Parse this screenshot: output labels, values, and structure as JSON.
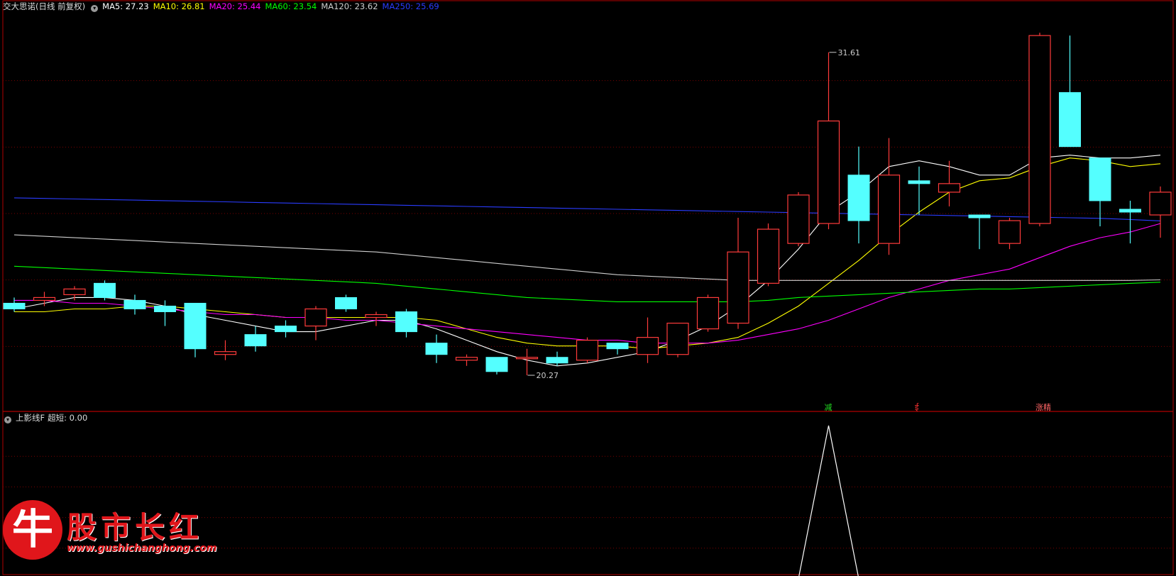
{
  "header": {
    "title": "交大思诺(日线 前复权)",
    "ma": [
      {
        "label": "MA5: 27.23",
        "color": "#ffffff"
      },
      {
        "label": "MA10: 26.81",
        "color": "#ffff00"
      },
      {
        "label": "MA20: 25.44",
        "color": "#ff00ff"
      },
      {
        "label": "MA60: 23.54",
        "color": "#00ff00"
      },
      {
        "label": "MA120: 23.62",
        "color": "#cfcfcf"
      },
      {
        "label": "MA250: 25.69",
        "color": "#2a3cff"
      }
    ]
  },
  "sub_header": {
    "name": "上影线F",
    "value_label": "超短: 0.00"
  },
  "watermark": {
    "name": "股市长红",
    "url": "www.gushichanghong.com",
    "mark": "牛"
  },
  "colors": {
    "up": "#ff3b3b",
    "down": "#54ffff",
    "grid": "#7a0000",
    "border": "#b00000"
  },
  "chart_data": [
    {
      "type": "candlestick",
      "ylim": [
        19.0,
        33.0
      ],
      "annotations": [
        {
          "index": 27,
          "value": 31.61,
          "label": "31.61"
        },
        {
          "index": 17,
          "value": 20.27,
          "label": "20.27"
        }
      ],
      "signals": [
        {
          "index": 27,
          "label": "减",
          "color": "#22dd22"
        },
        {
          "index": 30,
          "label": "ई",
          "color": "#ff3333"
        },
        {
          "index": 34,
          "label": "涨精",
          "color": "#ff6666"
        }
      ],
      "candles": [
        {
          "o": 22.8,
          "h": 23.0,
          "l": 22.5,
          "c": 22.6
        },
        {
          "o": 22.9,
          "h": 23.2,
          "l": 22.7,
          "c": 23.0
        },
        {
          "o": 23.1,
          "h": 23.4,
          "l": 22.9,
          "c": 23.3
        },
        {
          "o": 23.5,
          "h": 23.6,
          "l": 22.9,
          "c": 23.0
        },
        {
          "o": 22.9,
          "h": 23.1,
          "l": 22.4,
          "c": 22.6
        },
        {
          "o": 22.7,
          "h": 22.9,
          "l": 22.0,
          "c": 22.5
        },
        {
          "o": 22.8,
          "h": 22.8,
          "l": 20.9,
          "c": 21.2
        },
        {
          "o": 21.0,
          "h": 21.5,
          "l": 20.8,
          "c": 21.1
        },
        {
          "o": 21.7,
          "h": 22.0,
          "l": 21.1,
          "c": 21.3
        },
        {
          "o": 22.0,
          "h": 22.2,
          "l": 21.6,
          "c": 21.8
        },
        {
          "o": 22.0,
          "h": 22.7,
          "l": 21.5,
          "c": 22.6
        },
        {
          "o": 23.0,
          "h": 23.1,
          "l": 22.5,
          "c": 22.6
        },
        {
          "o": 22.3,
          "h": 22.5,
          "l": 22.0,
          "c": 22.4
        },
        {
          "o": 22.5,
          "h": 22.6,
          "l": 21.6,
          "c": 21.8
        },
        {
          "o": 21.4,
          "h": 21.7,
          "l": 20.7,
          "c": 21.0
        },
        {
          "o": 20.8,
          "h": 21.0,
          "l": 20.6,
          "c": 20.9
        },
        {
          "o": 20.9,
          "h": 20.9,
          "l": 20.3,
          "c": 20.4
        },
        {
          "o": 20.9,
          "h": 21.2,
          "l": 20.27,
          "c": 20.9
        },
        {
          "o": 20.9,
          "h": 21.1,
          "l": 20.6,
          "c": 20.7
        },
        {
          "o": 20.8,
          "h": 21.6,
          "l": 20.7,
          "c": 21.5
        },
        {
          "o": 21.4,
          "h": 21.4,
          "l": 21.0,
          "c": 21.2
        },
        {
          "o": 21.0,
          "h": 22.3,
          "l": 20.7,
          "c": 21.6
        },
        {
          "o": 21.0,
          "h": 22.0,
          "l": 20.9,
          "c": 22.1
        },
        {
          "o": 21.9,
          "h": 23.1,
          "l": 21.8,
          "c": 23.0
        },
        {
          "o": 22.1,
          "h": 25.8,
          "l": 21.9,
          "c": 24.6
        },
        {
          "o": 23.5,
          "h": 25.6,
          "l": 23.4,
          "c": 25.4
        },
        {
          "o": 24.9,
          "h": 26.7,
          "l": 24.8,
          "c": 26.6
        },
        {
          "o": 25.6,
          "h": 31.61,
          "l": 25.4,
          "c": 29.2
        },
        {
          "o": 27.3,
          "h": 28.3,
          "l": 24.9,
          "c": 25.7
        },
        {
          "o": 24.9,
          "h": 28.6,
          "l": 24.5,
          "c": 27.3
        },
        {
          "o": 27.1,
          "h": 27.6,
          "l": 25.9,
          "c": 27.0
        },
        {
          "o": 26.7,
          "h": 27.8,
          "l": 26.2,
          "c": 27.0
        },
        {
          "o": 25.9,
          "h": 25.9,
          "l": 24.7,
          "c": 25.8
        },
        {
          "o": 24.9,
          "h": 25.8,
          "l": 24.7,
          "c": 25.7
        },
        {
          "o": 25.6,
          "h": 32.3,
          "l": 25.5,
          "c": 32.2
        },
        {
          "o": 30.2,
          "h": 32.2,
          "l": 28.4,
          "c": 28.3
        },
        {
          "o": 27.9,
          "h": 27.9,
          "l": 25.5,
          "c": 26.4
        },
        {
          "o": 26.1,
          "h": 26.4,
          "l": 24.9,
          "c": 26.0
        },
        {
          "o": 25.9,
          "h": 26.9,
          "l": 25.1,
          "c": 26.7
        }
      ],
      "ma": [
        {
          "name": "MA5",
          "color": "#ffffff",
          "values": [
            22.6,
            22.8,
            23.0,
            23.0,
            22.9,
            22.7,
            22.4,
            22.2,
            22.0,
            21.8,
            21.8,
            22.0,
            22.2,
            22.2,
            21.9,
            21.5,
            21.1,
            20.8,
            20.6,
            20.7,
            20.9,
            21.1,
            21.5,
            22.0,
            22.7,
            23.6,
            24.7,
            26.0,
            26.7,
            27.6,
            27.8,
            27.6,
            27.3,
            27.3,
            27.9,
            28.0,
            27.9,
            27.9,
            28.0
          ]
        },
        {
          "name": "MA10",
          "color": "#ffff00",
          "values": [
            22.5,
            22.5,
            22.6,
            22.6,
            22.7,
            22.7,
            22.6,
            22.5,
            22.4,
            22.3,
            22.3,
            22.3,
            22.3,
            22.3,
            22.2,
            21.9,
            21.6,
            21.4,
            21.3,
            21.3,
            21.3,
            21.2,
            21.3,
            21.4,
            21.6,
            22.1,
            22.7,
            23.5,
            24.3,
            25.2,
            26.0,
            26.7,
            27.1,
            27.2,
            27.6,
            27.9,
            27.8,
            27.6,
            27.7
          ]
        },
        {
          "name": "MA20",
          "color": "#ff00ff",
          "values": [
            22.9,
            22.9,
            22.8,
            22.8,
            22.7,
            22.6,
            22.5,
            22.4,
            22.4,
            22.3,
            22.3,
            22.2,
            22.2,
            22.1,
            22.0,
            21.9,
            21.8,
            21.7,
            21.6,
            21.5,
            21.5,
            21.4,
            21.4,
            21.4,
            21.5,
            21.7,
            21.9,
            22.2,
            22.6,
            23.0,
            23.3,
            23.6,
            23.8,
            24.0,
            24.4,
            24.8,
            25.1,
            25.3,
            25.6
          ]
        },
        {
          "name": "MA60",
          "color": "#00ff00",
          "values": [
            24.1,
            24.05,
            24.0,
            23.95,
            23.9,
            23.85,
            23.8,
            23.75,
            23.7,
            23.65,
            23.6,
            23.55,
            23.5,
            23.4,
            23.3,
            23.2,
            23.1,
            23.0,
            22.95,
            22.9,
            22.85,
            22.85,
            22.85,
            22.85,
            22.85,
            22.9,
            23.0,
            23.05,
            23.1,
            23.15,
            23.2,
            23.25,
            23.3,
            23.3,
            23.35,
            23.4,
            23.45,
            23.5,
            23.54
          ]
        },
        {
          "name": "MA120",
          "color": "#cfcfcf",
          "values": [
            25.2,
            25.15,
            25.1,
            25.05,
            25.0,
            24.95,
            24.9,
            24.85,
            24.8,
            24.75,
            24.7,
            24.65,
            24.6,
            24.5,
            24.4,
            24.3,
            24.2,
            24.1,
            24.0,
            23.9,
            23.8,
            23.75,
            23.7,
            23.65,
            23.6,
            23.6,
            23.6,
            23.6,
            23.6,
            23.6,
            23.6,
            23.6,
            23.6,
            23.6,
            23.6,
            23.6,
            23.6,
            23.6,
            23.62
          ]
        },
        {
          "name": "MA250",
          "color": "#2a3cff",
          "values": [
            26.5,
            26.48,
            26.46,
            26.44,
            26.42,
            26.4,
            26.38,
            26.36,
            26.34,
            26.32,
            26.3,
            26.28,
            26.26,
            26.24,
            26.22,
            26.2,
            26.18,
            26.16,
            26.14,
            26.12,
            26.1,
            26.08,
            26.06,
            26.04,
            26.02,
            26.0,
            25.98,
            25.96,
            25.94,
            25.92,
            25.9,
            25.88,
            25.86,
            25.84,
            25.82,
            25.8,
            25.78,
            25.74,
            25.69
          ]
        }
      ]
    },
    {
      "type": "line",
      "name": "超短",
      "ylim": [
        0,
        1.0
      ],
      "values": [
        0,
        0,
        0,
        0,
        0,
        0,
        0,
        0,
        0,
        0,
        0,
        0,
        0,
        0,
        0,
        0,
        0,
        0,
        0,
        0,
        0,
        0,
        0,
        0,
        0,
        0,
        0,
        1.0,
        0,
        0,
        0,
        0,
        0,
        0,
        0,
        0,
        0,
        0,
        0
      ]
    }
  ]
}
